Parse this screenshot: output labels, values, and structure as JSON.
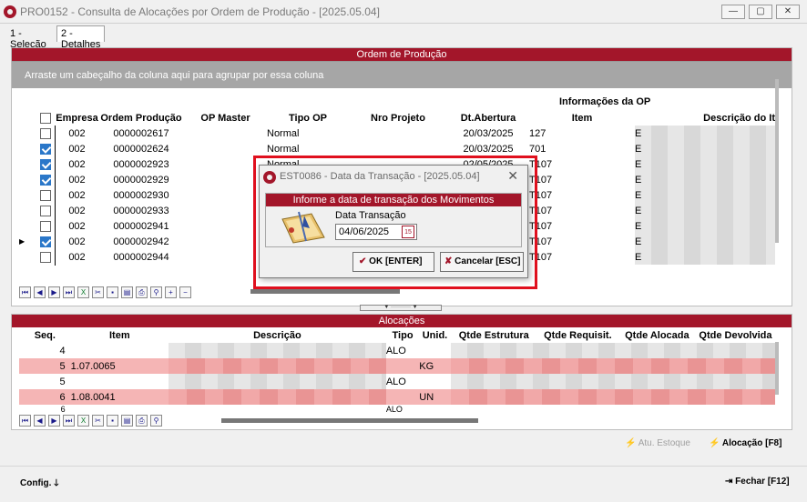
{
  "window": {
    "title": "PRO0152 - Consulta de Alocações por Ordem de Produção - [2025.05.04]",
    "tabs": [
      "1 - Seleção",
      "2 - Detalhes"
    ]
  },
  "ordem": {
    "section_title": "Ordem de Produção",
    "group_hint": "Arraste um cabeçalho da coluna aqui para agrupar por essa coluna",
    "group_header": "Informações da OP",
    "columns": [
      "Empresa",
      "Ordem Produção",
      "OP Master",
      "Tipo OP",
      "Nro Projeto",
      "Dt.Abertura",
      "Item",
      "Descrição do It"
    ],
    "rows": [
      {
        "empresa": "002",
        "ordem": "0000002617",
        "tipo": "Normal",
        "data": "20/03/2025",
        "item": "127",
        "desc": "E"
      },
      {
        "empresa": "002",
        "ordem": "0000002624",
        "tipo": "Normal",
        "data": "20/03/2025",
        "item": "701",
        "desc": "E"
      },
      {
        "empresa": "002",
        "ordem": "0000002923",
        "tipo": "Normal",
        "data": "02/05/2025",
        "item": "T107",
        "desc": "E"
      },
      {
        "empresa": "002",
        "ordem": "0000002929",
        "tipo": "",
        "data": "",
        "item": "T107",
        "desc": "E"
      },
      {
        "empresa": "002",
        "ordem": "0000002930",
        "tipo": "",
        "data": "",
        "item": "T107",
        "desc": "E"
      },
      {
        "empresa": "002",
        "ordem": "0000002933",
        "tipo": "",
        "data": "",
        "item": "T107",
        "desc": "E"
      },
      {
        "empresa": "002",
        "ordem": "0000002941",
        "tipo": "",
        "data": "",
        "item": "T107",
        "desc": "E"
      },
      {
        "empresa": "002",
        "ordem": "0000002942",
        "tipo": "",
        "data": "",
        "item": "T107",
        "desc": "E"
      },
      {
        "empresa": "002",
        "ordem": "0000002944",
        "tipo": "",
        "data": "",
        "item": "T107",
        "desc": "E"
      }
    ]
  },
  "alocacoes": {
    "section_title": "Alocações",
    "columns": [
      "Seq.",
      "Item",
      "Descrição",
      "Tipo",
      "Unid.",
      "Qtde Estrutura",
      "Qtde Requisit.",
      "Qtde Alocada",
      "Qtde Devolvida"
    ],
    "rows": [
      {
        "seq": "4",
        "item": "",
        "tipo": "ALO",
        "unid": ""
      },
      {
        "seq": "5",
        "item": "1.07.0065",
        "tipo": "",
        "unid": "KG"
      },
      {
        "seq": "5",
        "item": "",
        "tipo": "ALO",
        "unid": ""
      },
      {
        "seq": "6",
        "item": "1.08.0041",
        "tipo": "",
        "unid": "UN"
      },
      {
        "seq": "6",
        "item": "",
        "tipo": "ALO",
        "unid": ""
      }
    ]
  },
  "actions": {
    "atu_estoque": "Atu. Estoque",
    "alocacao": "Alocação [F8]",
    "config": "Config.",
    "fechar": "Fechar [F12]"
  },
  "dialog": {
    "title": "EST0086 - Data da Transação - [2025.05.04]",
    "section": "Informe a data de transação dos Movimentos",
    "field_label": "Data Transação",
    "field_value": "04/06/2025",
    "ok": "OK [ENTER]",
    "cancel": "Cancelar [ESC]"
  },
  "colors": {
    "accent": "#a3162a",
    "highlight": "#e0101e",
    "row_pink": "#f5b5b5"
  }
}
